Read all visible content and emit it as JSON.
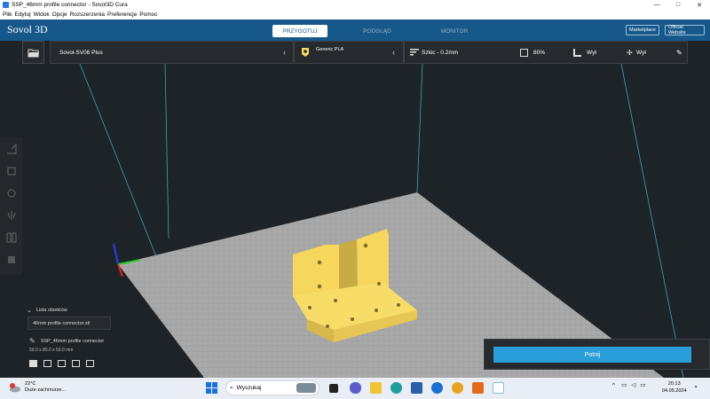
{
  "window": {
    "title": "SSP_46mm profile connector - Sovol3D Cura",
    "controls": [
      "—",
      "□",
      "✕"
    ]
  },
  "menu": [
    "Plik",
    "Edytuj",
    "Widok",
    "Opcje",
    "Rozszerzenia",
    "Preferencje",
    "Pomoc"
  ],
  "header": {
    "logo": "Sovol 3D",
    "tabs": [
      "PRZYGOTUJ",
      "PODGLĄD",
      "MONITOR"
    ],
    "active_tab": "PRZYGOTUJ",
    "marketplace": "Marketplace",
    "official_website": "Official Website"
  },
  "toolbar": {
    "printer": "Sovol-SV06 Plus",
    "material": "Generic PLA",
    "profile": "Szkic - 0.2mm",
    "infill": "80%",
    "support": "Wył",
    "adhesion": "Wył"
  },
  "objects": {
    "list_label": "Lista obiektów",
    "list_entry": "46mm profile connector.stl",
    "selected_name": "SSP_46mm profile connector",
    "dimensions": "50.0 x 80.0 x 50.0 mm"
  },
  "slice": {
    "button": "Potnij"
  },
  "taskbar": {
    "weather_temp": "22°C",
    "weather_desc": "Duże zachmurze...",
    "weather_badge": "1",
    "search_placeholder": "Wyszukaj",
    "time": "20:13",
    "date": "04.05.2024"
  },
  "colors": {
    "header_blue": "#16588a",
    "accent_blue": "#2a9ed8",
    "model_yellow": "#f6d65c",
    "build_plate": "#a9a9a9"
  }
}
